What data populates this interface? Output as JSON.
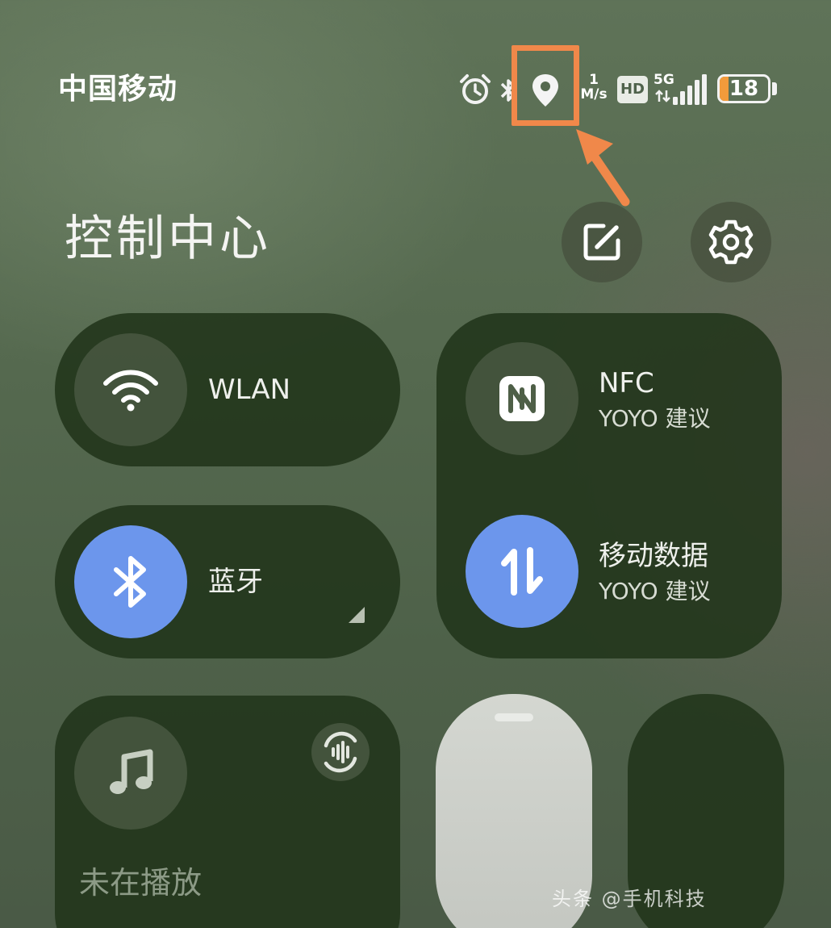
{
  "status_bar": {
    "carrier": "中国移动",
    "speed_value": "1",
    "speed_unit": "M/s",
    "hd_label": "HD",
    "network_type": "5G",
    "battery_level": "18",
    "battery_percent": 18,
    "icons": [
      "alarm-icon",
      "bluetooth-icon",
      "location-icon",
      "signal-icon",
      "battery-icon"
    ],
    "highlight_color": "#f0884a"
  },
  "header": {
    "title": "控制中心",
    "actions": [
      "edit-icon",
      "settings-icon"
    ]
  },
  "tiles": {
    "wlan": {
      "label": "WLAN",
      "active": false
    },
    "nfc": {
      "label": "NFC",
      "sub_label": "YOYO 建议",
      "active": false
    },
    "bluetooth": {
      "label": "蓝牙",
      "active": true
    },
    "mobile_data": {
      "label": "移动数据",
      "sub_label": "YOYO 建议",
      "active": true
    },
    "media": {
      "status": "未在播放"
    }
  },
  "colors": {
    "active_blue": "#6c96ec",
    "tile_dark": "#21341a",
    "annotation_orange": "#f0884a"
  },
  "watermark": "头条 @手机科技"
}
